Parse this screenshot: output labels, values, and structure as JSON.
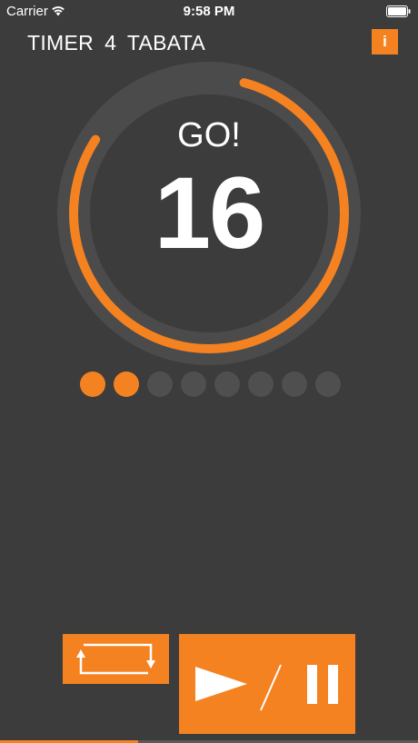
{
  "status_bar": {
    "carrier": "Carrier",
    "time": "9:58 PM"
  },
  "header": {
    "title_left": "TIMER",
    "timer_number": "4",
    "title_right": "TABATA",
    "info_label": "i"
  },
  "timer": {
    "phase": "GO!",
    "seconds_remaining": "16",
    "ring_progress": 0.8
  },
  "rounds": {
    "total": 8,
    "completed": 2
  },
  "controls": {
    "repeat_icon": "repeat-icon",
    "play_icon": "play-icon",
    "pause_icon": "pause-icon"
  },
  "session_progress": 0.33,
  "colors": {
    "accent": "#f58220",
    "background": "#3c3c3c",
    "ring_track": "#4b4b4b",
    "dot_inactive": "#4f4f4f"
  }
}
